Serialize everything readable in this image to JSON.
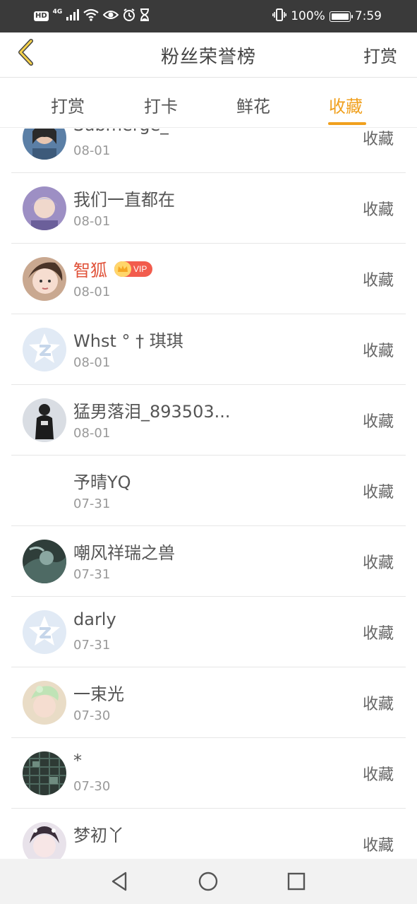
{
  "status_bar": {
    "hd": "HD",
    "network": "4G",
    "battery": "100%",
    "time": "7:59",
    "icons": [
      "signal-icon",
      "wifi-icon",
      "eye-icon",
      "alarm-icon",
      "hourglass-icon",
      "vibrate-icon",
      "battery-icon"
    ]
  },
  "header": {
    "title": "粉丝荣誉榜",
    "right_action": "打赏",
    "back_icon": "chevron-left-icon"
  },
  "tabs": [
    {
      "label": "打赏",
      "active": false
    },
    {
      "label": "打卡",
      "active": false
    },
    {
      "label": "鲜花",
      "active": false
    },
    {
      "label": "收藏",
      "active": true
    }
  ],
  "colors": {
    "accent": "#f0a01e",
    "vip_name": "#e0533a",
    "vip_badge": "#f25c4d"
  },
  "vip_label": "VIP",
  "rows": [
    {
      "name": "Submerge_",
      "date": "08-01",
      "action": "收藏",
      "avatar": "photo-dark"
    },
    {
      "name": "我们一直都在",
      "date": "08-01",
      "action": "收藏",
      "avatar": "photo-purple"
    },
    {
      "name": "智狐",
      "date": "08-01",
      "action": "收藏",
      "avatar": "photo-face",
      "vip": true
    },
    {
      "name": "Whst ° † 琪琪",
      "date": "08-01",
      "action": "收藏",
      "avatar": "default-z"
    },
    {
      "name": "猛男落泪_893503...",
      "date": "08-01",
      "action": "收藏",
      "avatar": "photo-figure"
    },
    {
      "name": "予晴YQ",
      "date": "07-31",
      "action": "收藏",
      "avatar": "none"
    },
    {
      "name": "嘲风祥瑞之兽",
      "date": "07-31",
      "action": "收藏",
      "avatar": "photo-teal"
    },
    {
      "name": "darly",
      "date": "07-31",
      "action": "收藏",
      "avatar": "default-z"
    },
    {
      "name": "一束光",
      "date": "07-30",
      "action": "收藏",
      "avatar": "photo-green"
    },
    {
      "name": "*",
      "date": "07-30",
      "action": "收藏",
      "avatar": "photo-map"
    },
    {
      "name": "梦初丫",
      "date": "",
      "action": "收藏",
      "avatar": "photo-anime"
    }
  ],
  "nav_bar": [
    "back-triangle-icon",
    "home-circle-icon",
    "recents-square-icon"
  ]
}
